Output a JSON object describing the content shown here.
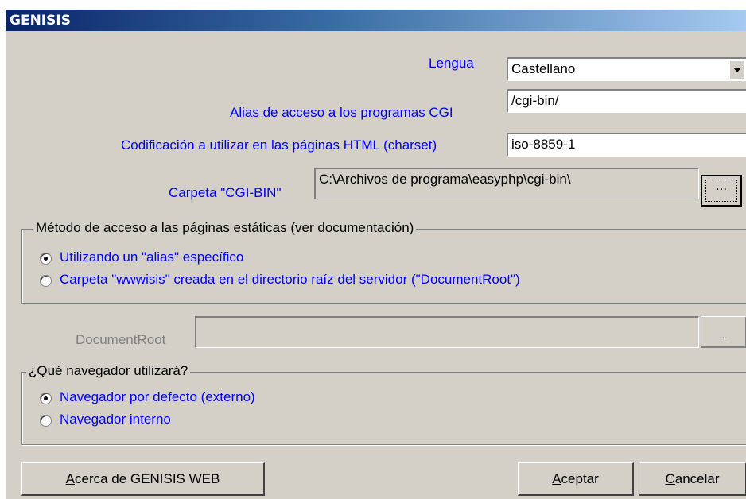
{
  "window": {
    "title": "GENISIS"
  },
  "form": {
    "lengua_label": "Lengua",
    "lengua_value": "Castellano",
    "alias_label": "Alias de acceso a los programas CGI",
    "alias_value": "/cgi-bin/",
    "charset_label": "Codificación a utilizar en las páginas HTML (charset)",
    "charset_value": "iso-8859-1",
    "cgibin_label": "Carpeta \"CGI-BIN\"",
    "cgibin_value": "C:\\Archivos de programa\\easyphp\\cgi-bin\\",
    "browse_label": "...",
    "docroot_label": "DocumentRoot",
    "docroot_value": "",
    "docroot_browse_label": "..."
  },
  "metodo_group": {
    "legend": "Método de acceso a las páginas estáticas (ver documentación)",
    "options": [
      {
        "label": "Utilizando un \"alias\" específico",
        "checked": true
      },
      {
        "label": "Carpeta \"wwwisis\" creada en el directorio raíz del servidor (\"DocumentRoot\")",
        "checked": false
      }
    ]
  },
  "navegador_group": {
    "legend": "¿Qué navegador utilizará?",
    "options": [
      {
        "label": "Navegador por defecto (externo)",
        "checked": true
      },
      {
        "label": "Navegador interno",
        "checked": false
      }
    ]
  },
  "buttons": {
    "about_mnemonic": "A",
    "about_rest": "cerca de GENISIS WEB",
    "accept_mnemonic": "A",
    "accept_rest": "ceptar",
    "cancel_mnemonic": "C",
    "cancel_rest": "ancelar"
  },
  "colors": {
    "label_blue": "#0000ff",
    "window_bg": "#d4d0c8",
    "title_start": "#0a246a",
    "title_end": "#a6caf0"
  }
}
